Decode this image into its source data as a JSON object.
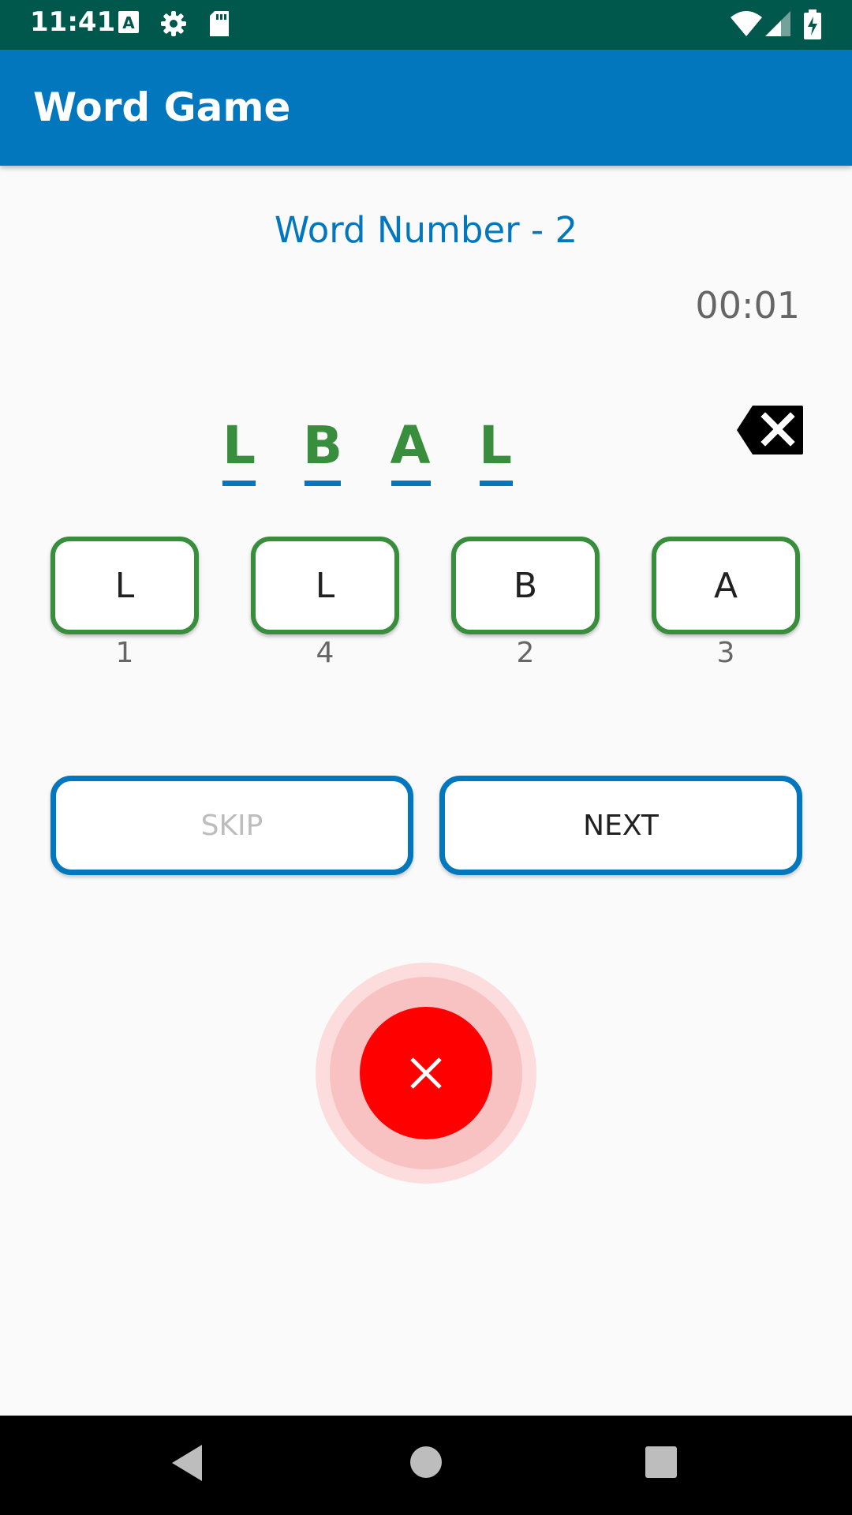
{
  "status_bar": {
    "time": "11:41",
    "left_icons": [
      "a-icon",
      "gear-icon",
      "sd-card-icon"
    ],
    "right_icons": [
      "wifi-icon",
      "signal-icon",
      "battery-charging-icon"
    ]
  },
  "app_bar": {
    "title": "Word Game"
  },
  "game": {
    "word_number": "Word Number - 2",
    "timer": "00:01",
    "answer_letters": [
      "L",
      "B",
      "A",
      "L"
    ],
    "tiles": [
      {
        "letter": "L",
        "index": "1"
      },
      {
        "letter": "L",
        "index": "4"
      },
      {
        "letter": "B",
        "index": "2"
      },
      {
        "letter": "A",
        "index": "3"
      }
    ]
  },
  "actions": {
    "skip_label": "SKIP",
    "next_label": "NEXT"
  },
  "colors": {
    "primary": "#0277bd",
    "status_bar": "#00574b",
    "tile_border": "#388e3c",
    "fab": "#ff0000"
  },
  "nav": {
    "buttons": [
      "back-icon",
      "home-icon",
      "recents-icon"
    ]
  }
}
